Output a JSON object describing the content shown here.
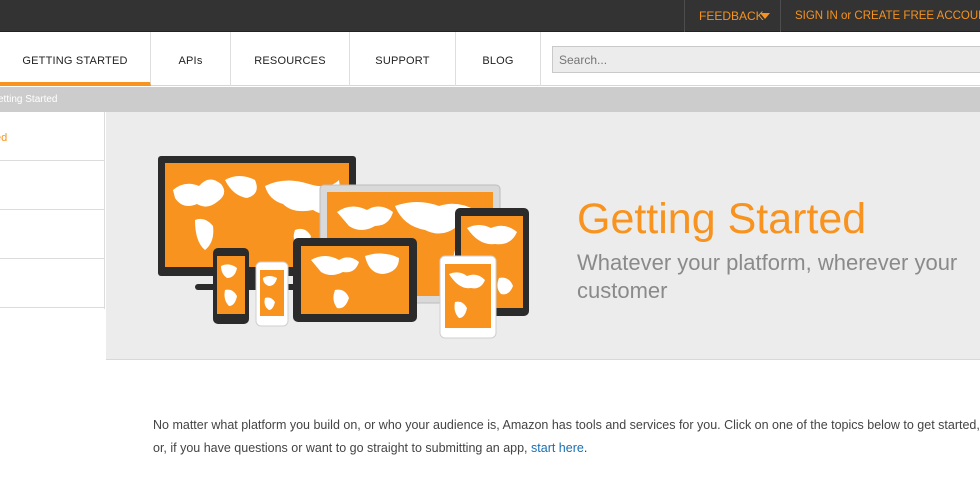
{
  "topbar": {
    "feedback": "FEEDBACK",
    "signin": "SIGN IN or CREATE FREE ACCOUNT"
  },
  "nav": {
    "tabs": [
      {
        "label": "GETTING STARTED",
        "active": true
      },
      {
        "label": "APIs",
        "active": false
      },
      {
        "label": "RESOURCES",
        "active": false
      },
      {
        "label": "SUPPORT",
        "active": false
      },
      {
        "label": "BLOG",
        "active": false
      }
    ],
    "search_placeholder": "Search..."
  },
  "breadcrumb": "etting Started",
  "sidebar": {
    "items": [
      {
        "label": "ed"
      },
      {
        "label": ""
      },
      {
        "label": ""
      },
      {
        "label": ""
      }
    ]
  },
  "hero": {
    "title": "Getting Started",
    "subtitle": "Whatever your platform, wherever your customer"
  },
  "intro": {
    "text": "No matter what platform you build on, or who your audience is, Amazon has tools and services for you. Click on one of the topics below to get started, or, if you have questions or want to go straight to submitting an app, ",
    "link": "start here",
    "tail": "."
  },
  "colors": {
    "accent": "#f7931e",
    "topbar": "#333333",
    "hero_bg": "#ececec",
    "link": "#1a6fb0"
  }
}
